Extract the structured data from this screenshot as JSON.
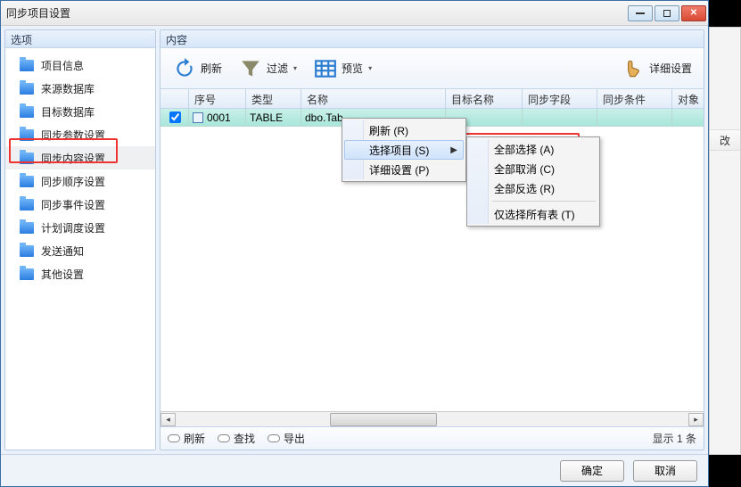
{
  "window": {
    "title": "同步项目设置"
  },
  "sidebar": {
    "header": "选项",
    "items": [
      {
        "label": "项目信息"
      },
      {
        "label": "来源数据库"
      },
      {
        "label": "目标数据库"
      },
      {
        "label": "同步参数设置"
      },
      {
        "label": "同步内容设置"
      },
      {
        "label": "同步顺序设置"
      },
      {
        "label": "同步事件设置"
      },
      {
        "label": "计划调度设置"
      },
      {
        "label": "发送通知"
      },
      {
        "label": "其他设置"
      }
    ],
    "selected_index": 4
  },
  "main": {
    "header": "内容",
    "toolbar": {
      "refresh": "刷新",
      "filter": "过滤",
      "preview": "预览",
      "detail": "详细设置"
    },
    "columns": {
      "seq": "序号",
      "type": "类型",
      "name": "名称",
      "target_name": "目标名称",
      "sync_field": "同步字段",
      "sync_cond": "同步条件",
      "obj": "对象"
    },
    "rows": [
      {
        "seq": "0001",
        "type": "TABLE",
        "name": "dbo.Tab",
        "checked": true
      }
    ]
  },
  "context_menu": {
    "items": [
      {
        "label": "刷新 (R)"
      },
      {
        "label": "选择项目 (S)"
      },
      {
        "label": "详细设置 (P)"
      }
    ],
    "highlight_index": 1,
    "sub": {
      "items": [
        {
          "label": "全部选择 (A)"
        },
        {
          "label": "全部取消 (C)"
        },
        {
          "label": "全部反选 (R)"
        },
        {
          "label": "仅选择所有表 (T)"
        }
      ],
      "highlight_sep_after": 2
    }
  },
  "statusbar": {
    "refresh": "刷新",
    "find": "查找",
    "export": "导出",
    "count_text": "显示 1 条"
  },
  "buttons": {
    "ok": "确定",
    "cancel": "取消"
  },
  "bg": {
    "button": "改"
  }
}
